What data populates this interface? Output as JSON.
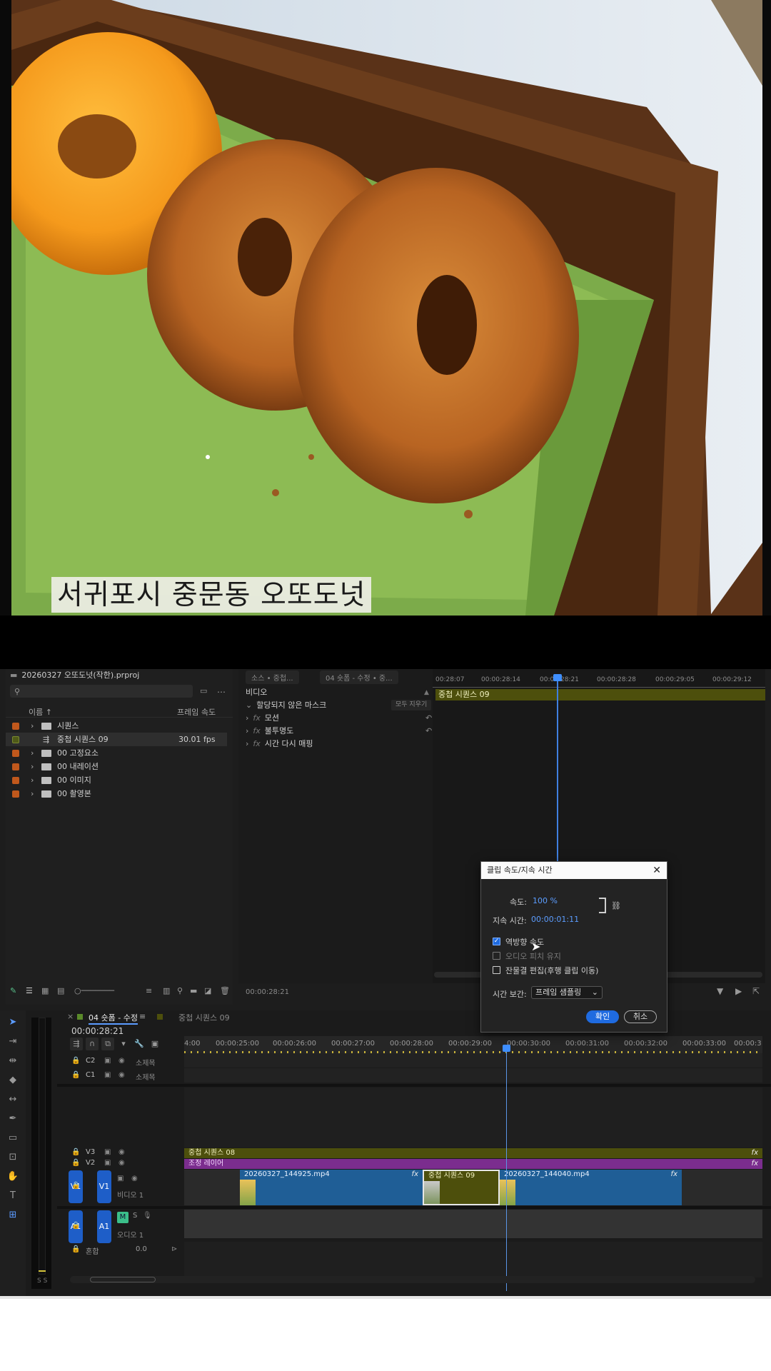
{
  "video": {
    "caption": "서귀포시 중문동 오또도넛"
  },
  "project": {
    "title": "20260327 오또도넛(작한).prproj",
    "col_name": "이름 ↑",
    "col_fps": "프레임 속도",
    "rows": [
      {
        "name": "시퀀스",
        "fps": "",
        "color": "#c0581c"
      },
      {
        "name": "중첩 시퀀스 09",
        "fps": "30.01 fps",
        "color": "#4f5a18"
      },
      {
        "name": "00 고정요소",
        "fps": "",
        "color": "#c0581c"
      },
      {
        "name": "00 내레이션",
        "fps": "",
        "color": "#c0581c"
      },
      {
        "name": "00 이미지",
        "fps": "",
        "color": "#c0581c"
      },
      {
        "name": "00 촬영본",
        "fps": "",
        "color": "#c0581c"
      }
    ]
  },
  "effects": {
    "tab1": "소스 • 중첩...",
    "tab2": "04 숏폼 - 수정 • 중...",
    "section": "비디오",
    "mask_label": "할당되지 않은 마스크",
    "clear_all": "모두 지우기",
    "items": [
      "모션",
      "불투명도",
      "시간 다시 매핑"
    ],
    "timecode": "00:00:28:21",
    "clip_name": "중첩 시퀀스 09",
    "ruler": [
      "00:28:07",
      "00:00:28:14",
      "00:00:28:21",
      "00:00:28:28",
      "00:00:29:05",
      "00:00:29:12"
    ]
  },
  "timeline": {
    "tab_active": "04 숏폼 - 수정",
    "tab_other": "중첩 시퀀스 09",
    "timecode": "00:00:28:21",
    "ruler": [
      "4:00",
      "00:00:25:00",
      "00:00:26:00",
      "00:00:27:00",
      "00:00:28:00",
      "00:00:29:00",
      "00:00:30:00",
      "00:00:31:00",
      "00:00:32:00",
      "00:00:33:00",
      "00:00:3"
    ],
    "tracks": {
      "c2": "C2",
      "c1": "C1",
      "caption_name": "소제목",
      "v3": "V3",
      "v2": "V2",
      "v1": "V1",
      "v1_name": "비디오 1",
      "a1": "A1",
      "a1_name": "오디오 1",
      "mix": "혼합",
      "mix_val": "0.0",
      "m": "M",
      "s": "S"
    },
    "clips": {
      "v3": "중첩 시퀀스 08",
      "v2": "조정 레이어",
      "v1a": "20260327_144925.mp4",
      "v1b": "중첩 시퀀스 09",
      "v1c": "20260327_144040.mp4",
      "fx": "fx"
    },
    "meter_label": "S S"
  },
  "dialog": {
    "title": "클립 속도/지속 시간",
    "speed_label": "속도:",
    "speed_value": "100 %",
    "duration_label": "지속 시간:",
    "duration_value": "00:00:01:11",
    "reverse_label": "역방향 속도",
    "reverse_checked": true,
    "pitch_label": "오디오 피치 유지",
    "pitch_checked": false,
    "ripple_label": "잔물결 편집(후행 클립 이동)",
    "ripple_checked": false,
    "interp_label": "시간 보간:",
    "interp_value": "프레임 샘플링",
    "ok": "확인",
    "cancel": "취소"
  }
}
